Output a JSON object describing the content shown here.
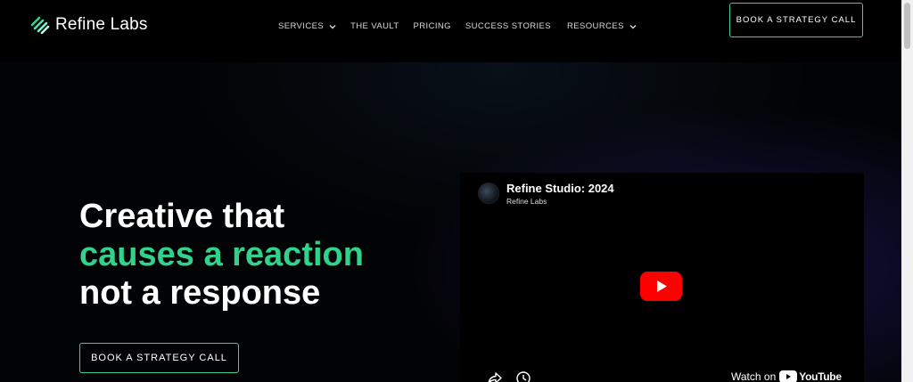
{
  "brand": {
    "name": "Refine Labs",
    "accent_color": "#2fd38c",
    "logo_icon": "stripes-logo-icon"
  },
  "nav": {
    "items": [
      {
        "label": "SERVICES",
        "has_dropdown": true
      },
      {
        "label": "THE VAULT",
        "has_dropdown": false
      },
      {
        "label": "PRICING",
        "has_dropdown": false
      },
      {
        "label": "SUCCESS STORIES",
        "has_dropdown": false
      },
      {
        "label": "RESOURCES",
        "has_dropdown": true
      }
    ],
    "cta_label": "BOOK A STRATEGY CALL"
  },
  "hero": {
    "title_line1": "Creative that",
    "title_line2": "causes a reaction",
    "title_line3": "not a response",
    "cta_label": "BOOK A STRATEGY CALL"
  },
  "video": {
    "title": "Refine Studio: 2024",
    "channel": "Refine Labs",
    "watch_on_label": "Watch on",
    "platform_label": "YouTube",
    "play_color": "#ff0000",
    "icons": [
      "share-icon",
      "watch-later-icon",
      "play-icon",
      "youtube-icon"
    ]
  }
}
